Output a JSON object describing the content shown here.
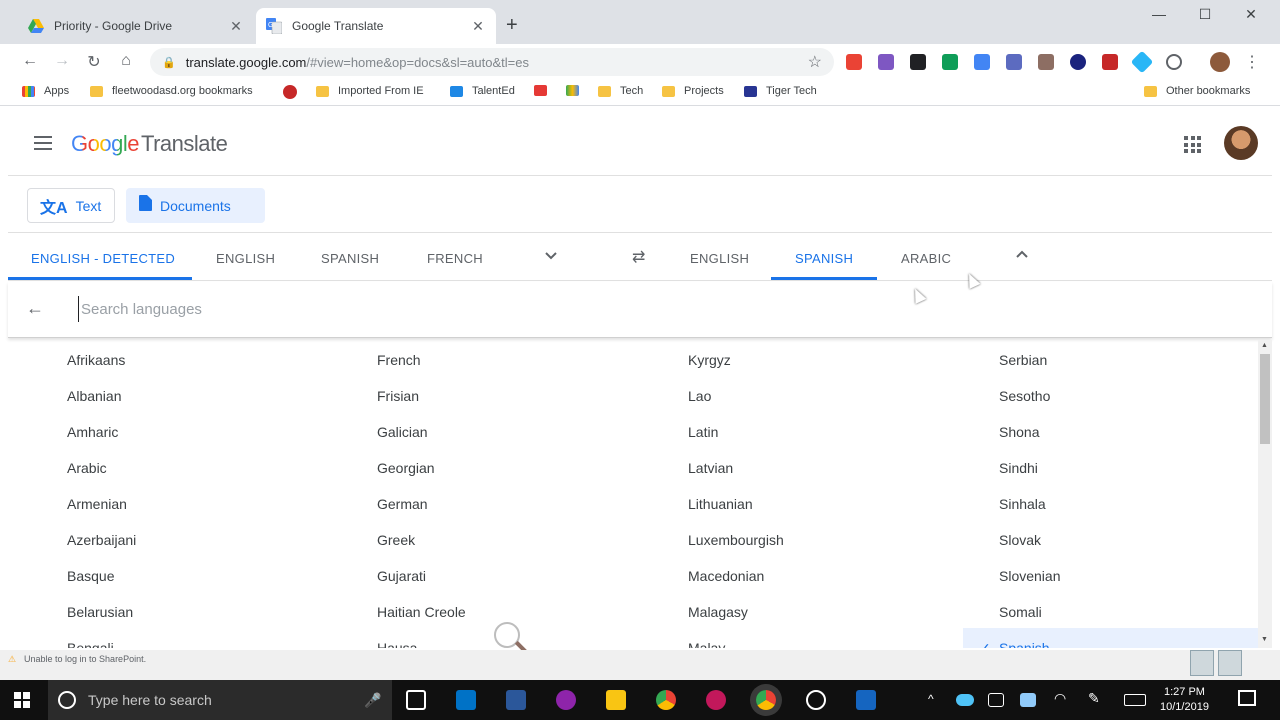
{
  "browser": {
    "tabs": [
      {
        "title": "Priority - Google Drive",
        "icon": "google-drive-icon"
      },
      {
        "title": "Google Translate",
        "icon": "google-translate-icon"
      }
    ],
    "url_host": "translate.google.com",
    "url_path": "/#view=home&op=docs&sl=auto&tl=es",
    "bookmarks": [
      {
        "label": "Apps"
      },
      {
        "label": "fleetwoodasd.org bookmarks"
      },
      {
        "label": "Imported From IE"
      },
      {
        "label": "TalentEd"
      },
      {
        "label": "Tech"
      },
      {
        "label": "Projects"
      },
      {
        "label": "Tiger Tech"
      },
      {
        "label": "Other bookmarks"
      }
    ]
  },
  "app": {
    "logo_google": "Google",
    "logo_product": "Translate",
    "modes": {
      "text": "Text",
      "documents": "Documents"
    },
    "source_langs": [
      "ENGLISH - DETECTED",
      "ENGLISH",
      "SPANISH",
      "FRENCH"
    ],
    "target_langs": [
      "ENGLISH",
      "SPANISH",
      "ARABIC"
    ],
    "search_placeholder": "Search languages",
    "languages": {
      "col1": [
        "Afrikaans",
        "Albanian",
        "Amharic",
        "Arabic",
        "Armenian",
        "Azerbaijani",
        "Basque",
        "Belarusian",
        "Bengali"
      ],
      "col2": [
        "French",
        "Frisian",
        "Galician",
        "Georgian",
        "German",
        "Greek",
        "Gujarati",
        "Haitian Creole",
        "Hausa"
      ],
      "col3": [
        "Kyrgyz",
        "Lao",
        "Latin",
        "Latvian",
        "Lithuanian",
        "Luxembourgish",
        "Macedonian",
        "Malagasy",
        "Malay"
      ],
      "col4": [
        "Serbian",
        "Sesotho",
        "Shona",
        "Sindhi",
        "Sinhala",
        "Slovak",
        "Slovenian",
        "Somali",
        "Spanish"
      ]
    },
    "selected_language": "Spanish"
  },
  "status_message": "Unable to log in to SharePoint.",
  "taskbar": {
    "search_placeholder": "Type here to search",
    "time": "1:27 PM",
    "date": "10/1/2019"
  },
  "colors": {
    "accent": "#1a73e8",
    "selected_bg": "#e8f0fe"
  }
}
